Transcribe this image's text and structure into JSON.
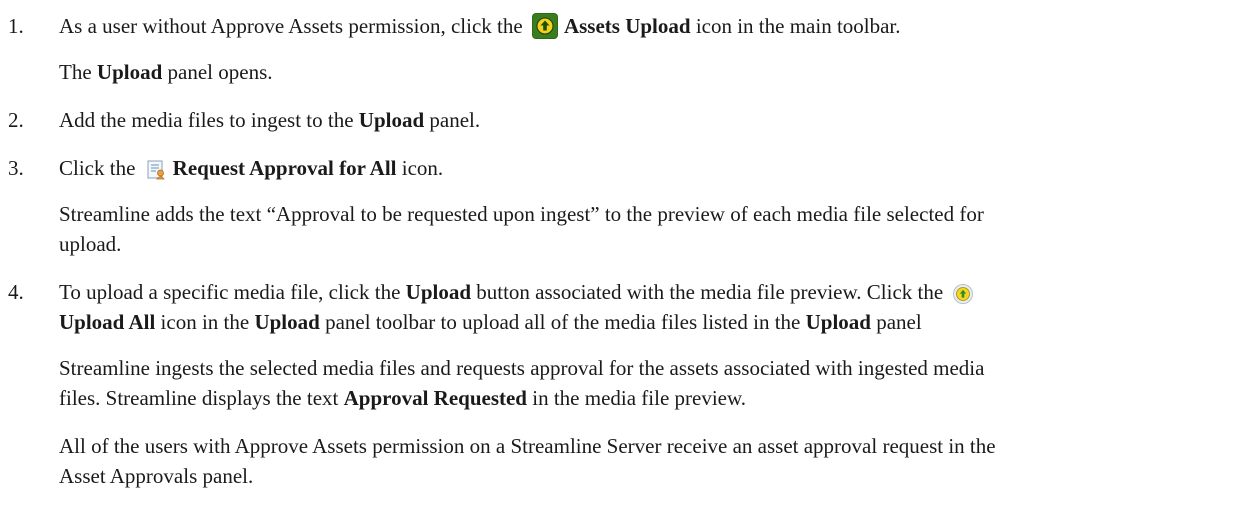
{
  "steps": [
    {
      "number": "1.",
      "line": {
        "before": "As a user without Approve Assets permission, click the ",
        "icon_name": "assets-upload-icon",
        "bold": "Assets Upload",
        "after": " icon in the main toolbar."
      },
      "result": {
        "bold": "Upload",
        "after": " panel opens.",
        "before": "The "
      }
    },
    {
      "number": "2.",
      "line": {
        "before": "Add the media files to ingest to the ",
        "bold": "Upload",
        "after": " panel."
      }
    },
    {
      "number": "3.",
      "line": {
        "before": "Click the ",
        "icon_name": "request-approval-icon",
        "bold": "Request Approval for All",
        "after": " icon."
      },
      "result_line1": "Streamline adds the text “Approval to be requested upon ingest” to the preview of each media file selected for",
      "result_line2": "upload."
    },
    {
      "number": "4.",
      "line1": {
        "before": "To upload a specific media file, click the ",
        "bold1": "Upload",
        "middle": " button associated with the media file preview. Click the "
      },
      "icon_name": "upload-all-icon",
      "line2": {
        "bold1": "Upload All",
        "middle1": " icon in the ",
        "bold2": "Upload",
        "middle2": " panel toolbar to upload all of the media files listed in the ",
        "bold3": "Upload",
        "after": " panel"
      },
      "result1_line1": "Streamline ingests the selected media files and requests approval for the assets associated with ingested media",
      "result1_line2_before": "files. Streamline displays the text ",
      "result1_line2_bold": "Approval Requested",
      "result1_line2_after": " in the media file preview.",
      "result2_line1": "All of the users with Approve Assets permission on a Streamline Server receive an asset approval request in the",
      "result2_line2": "Asset Approvals panel."
    }
  ],
  "colors": {
    "upload_icon_bg": "#3a7d1f",
    "upload_icon_circle": "#f2d21a",
    "upload_all_icon_circle": "#f5d61c",
    "upload_all_icon_arrow": "#2f8a2f"
  }
}
